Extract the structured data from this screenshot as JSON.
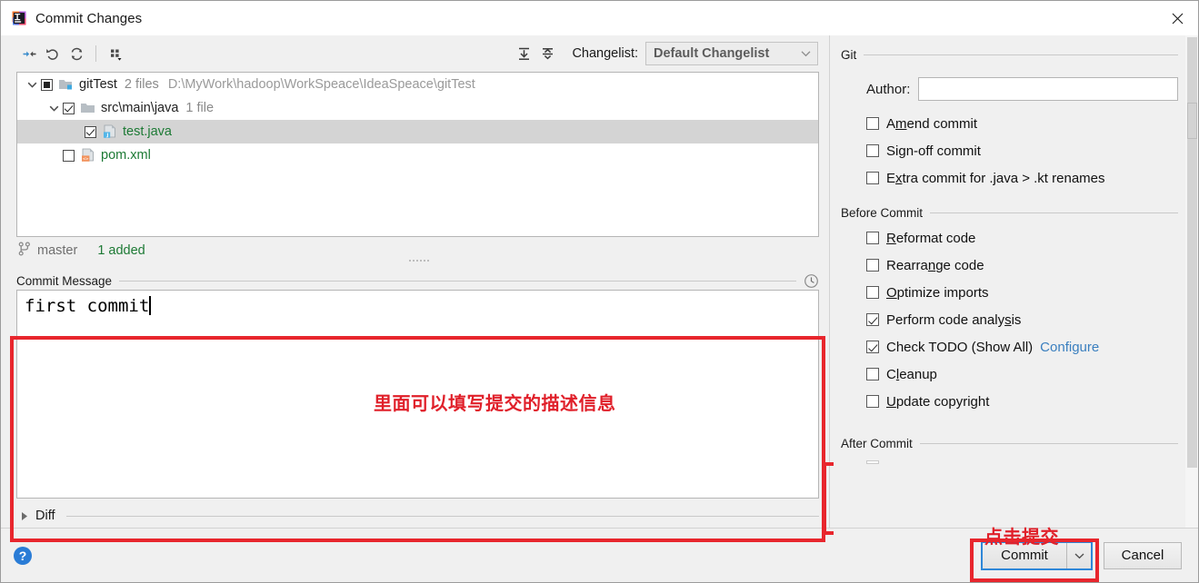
{
  "window": {
    "title": "Commit Changes",
    "app_icon": "intellij-idea-logo",
    "close_icon": "close-icon"
  },
  "toolbar": {
    "icons": [
      {
        "name": "collapse-all-icon",
        "title": "Collapse All"
      },
      {
        "name": "revert-icon",
        "title": "Revert"
      },
      {
        "name": "refresh-icon",
        "title": "Refresh"
      },
      {
        "name": "group-by-icon",
        "title": "Group By"
      }
    ],
    "expand_icon": "expand-all-icon",
    "collapse_icon": "collapse-all-icon",
    "changelist_label": "Changelist:",
    "changelist_value": "Default Changelist",
    "changelist_arrow": "chevron-down-icon"
  },
  "tree": {
    "rows": [
      {
        "indent": 0,
        "twisty": "chevron-down-icon",
        "check": "partial",
        "icon": "module-folder-icon",
        "name": "gitTest",
        "name_color": "dark",
        "meta": "2 files",
        "path": "D:\\MyWork\\hadoop\\WorkSpeace\\IdeaSpeace\\gitTest",
        "selected": false
      },
      {
        "indent": 1,
        "twisty": "chevron-down-icon",
        "check": "checked",
        "icon": "folder-icon",
        "name": "src\\main\\java",
        "name_color": "dark",
        "meta": "1 file",
        "path": "",
        "selected": false
      },
      {
        "indent": 2,
        "twisty": "none",
        "check": "checked",
        "icon": "java-file-icon",
        "name": "test.java",
        "name_color": "green",
        "meta": "",
        "path": "",
        "selected": true
      },
      {
        "indent": 1,
        "twisty": "none",
        "check": "unchecked",
        "icon": "xml-file-icon",
        "name": "pom.xml",
        "name_color": "green",
        "meta": "",
        "path": "",
        "selected": false
      }
    ]
  },
  "branch_bar": {
    "icon": "git-branch-icon",
    "branch": "master",
    "added": "1 added"
  },
  "commit_message": {
    "title": "Commit Message",
    "history_icon": "clock-history-icon",
    "value": "first commit",
    "placeholder": ""
  },
  "diff": {
    "twisty": "chevron-right-icon",
    "label": "Diff"
  },
  "options": {
    "git": {
      "title": "Git",
      "author_label": "Author:",
      "author_value": "",
      "author_placeholder": "",
      "checkboxes": [
        {
          "label_pre": "A",
          "label_mn": "m",
          "label_post": "end commit",
          "checked": false,
          "name": "amend-commit"
        },
        {
          "label_pre": "Si",
          "label_mn": "g",
          "label_post": "n-off commit",
          "checked": false,
          "name": "sign-off-commit"
        },
        {
          "label_pre": "E",
          "label_mn": "x",
          "label_post": "tra commit for .java > .kt renames",
          "checked": false,
          "name": "extra-commit-renames"
        }
      ]
    },
    "before_commit": {
      "title": "Before Commit",
      "checkboxes": [
        {
          "label_pre": "",
          "label_mn": "R",
          "label_post": "eformat code",
          "checked": false,
          "name": "reformat-code"
        },
        {
          "label_pre": "Rearra",
          "label_mn": "n",
          "label_post": "ge code",
          "checked": false,
          "name": "rearrange-code"
        },
        {
          "label_pre": "",
          "label_mn": "O",
          "label_post": "ptimize imports",
          "checked": false,
          "name": "optimize-imports"
        },
        {
          "label_pre": "Perform code analy",
          "label_mn": "s",
          "label_post": "is",
          "checked": true,
          "name": "perform-code-analysis"
        },
        {
          "label_pre": "Check TODO (Show All)",
          "label_mn": "",
          "label_post": "",
          "checked": true,
          "name": "check-todo",
          "link": "Configure"
        },
        {
          "label_pre": "C",
          "label_mn": "l",
          "label_post": "eanup",
          "checked": false,
          "name": "cleanup"
        },
        {
          "label_pre": "",
          "label_mn": "U",
          "label_post": "pdate copyright",
          "checked": false,
          "name": "update-copyright"
        }
      ]
    },
    "after_commit": {
      "title": "After Commit"
    }
  },
  "annotations": {
    "commit_message_note": "里面可以填写提交的描述信息",
    "commit_button_note": "点击提交",
    "color": "#e0202a",
    "box_color": "#e8262d"
  },
  "footer": {
    "help_icon": "help-icon",
    "help_glyph": "?",
    "commit_label": "Commit",
    "commit_arrow": "chevron-down-icon",
    "cancel_label": "Cancel",
    "focus_color": "#2f87d8"
  }
}
